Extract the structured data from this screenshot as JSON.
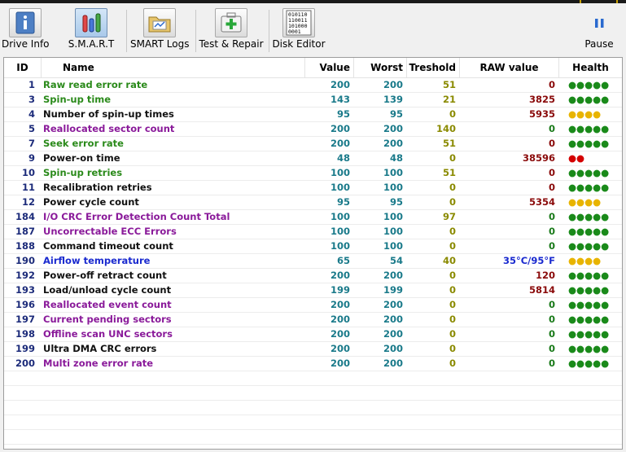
{
  "toolbar": {
    "buttons": [
      {
        "label": "Drive Info",
        "icon": "info-icon"
      },
      {
        "label": "S.M.A.R.T",
        "icon": "smart-chart-icon",
        "active": true
      },
      {
        "label": "SMART Logs",
        "icon": "logs-folder-icon"
      },
      {
        "label": "Test & Repair",
        "icon": "medkit-icon"
      },
      {
        "label": "Disk Editor",
        "icon": "binary-editor-icon"
      },
      {
        "label": "Pause",
        "icon": "pause-icon"
      }
    ],
    "disk_editor_glyph": [
      "010110",
      "110011",
      "101000",
      "0001"
    ]
  },
  "table": {
    "headers": {
      "id": "ID",
      "name": "Name",
      "value": "Value",
      "worst": "Worst",
      "threshold": "Treshold",
      "raw": "RAW value",
      "health": "Health"
    },
    "colors": {
      "green": "#2a8a1a",
      "purple": "#8a1a9a",
      "black": "#111111",
      "blue": "#1a2acf",
      "raw_red": "#8a0a0a",
      "raw_green": "#1a7a1a",
      "health_green": "#1a8a1a",
      "health_yellow": "#e8b400",
      "health_red": "#d40000"
    },
    "rows": [
      {
        "id": "1",
        "name": "Raw read error rate",
        "value": "200",
        "worst": "200",
        "threshold": "51",
        "raw": "0",
        "health": "●●●●●",
        "name_color": "green",
        "raw_color": "raw_red",
        "health_color": "health_green"
      },
      {
        "id": "3",
        "name": "Spin-up time",
        "value": "143",
        "worst": "139",
        "threshold": "21",
        "raw": "3825",
        "health": "●●●●●",
        "name_color": "green",
        "raw_color": "raw_red",
        "health_color": "health_green"
      },
      {
        "id": "4",
        "name": "Number of spin-up times",
        "value": "95",
        "worst": "95",
        "threshold": "0",
        "raw": "5935",
        "health": "●●●●",
        "name_color": "black",
        "raw_color": "raw_red",
        "health_color": "health_yellow"
      },
      {
        "id": "5",
        "name": "Reallocated sector count",
        "value": "200",
        "worst": "200",
        "threshold": "140",
        "raw": "0",
        "health": "●●●●●",
        "name_color": "purple",
        "raw_color": "raw_green",
        "health_color": "health_green"
      },
      {
        "id": "7",
        "name": "Seek error rate",
        "value": "200",
        "worst": "200",
        "threshold": "51",
        "raw": "0",
        "health": "●●●●●",
        "name_color": "green",
        "raw_color": "raw_red",
        "health_color": "health_green"
      },
      {
        "id": "9",
        "name": "Power-on time",
        "value": "48",
        "worst": "48",
        "threshold": "0",
        "raw": "38596",
        "health": "●●",
        "name_color": "black",
        "raw_color": "raw_red",
        "health_color": "health_red"
      },
      {
        "id": "10",
        "name": "Spin-up retries",
        "value": "100",
        "worst": "100",
        "threshold": "51",
        "raw": "0",
        "health": "●●●●●",
        "name_color": "green",
        "raw_color": "raw_red",
        "health_color": "health_green"
      },
      {
        "id": "11",
        "name": "Recalibration retries",
        "value": "100",
        "worst": "100",
        "threshold": "0",
        "raw": "0",
        "health": "●●●●●",
        "name_color": "black",
        "raw_color": "raw_red",
        "health_color": "health_green"
      },
      {
        "id": "12",
        "name": "Power cycle count",
        "value": "95",
        "worst": "95",
        "threshold": "0",
        "raw": "5354",
        "health": "●●●●",
        "name_color": "black",
        "raw_color": "raw_red",
        "health_color": "health_yellow"
      },
      {
        "id": "184",
        "name": "I/O CRC Error Detection Count Total",
        "value": "100",
        "worst": "100",
        "threshold": "97",
        "raw": "0",
        "health": "●●●●●",
        "name_color": "purple",
        "raw_color": "raw_green",
        "health_color": "health_green"
      },
      {
        "id": "187",
        "name": "Uncorrectable ECC Errors",
        "value": "100",
        "worst": "100",
        "threshold": "0",
        "raw": "0",
        "health": "●●●●●",
        "name_color": "purple",
        "raw_color": "raw_green",
        "health_color": "health_green"
      },
      {
        "id": "188",
        "name": "Command timeout count",
        "value": "100",
        "worst": "100",
        "threshold": "0",
        "raw": "0",
        "health": "●●●●●",
        "name_color": "black",
        "raw_color": "raw_green",
        "health_color": "health_green"
      },
      {
        "id": "190",
        "name": "Airflow temperature",
        "value": "65",
        "worst": "54",
        "threshold": "40",
        "raw": "35°C/95°F",
        "health": "●●●●",
        "name_color": "blue",
        "raw_color": "blue",
        "health_color": "health_yellow"
      },
      {
        "id": "192",
        "name": "Power-off retract count",
        "value": "200",
        "worst": "200",
        "threshold": "0",
        "raw": "120",
        "health": "●●●●●",
        "name_color": "black",
        "raw_color": "raw_red",
        "health_color": "health_green"
      },
      {
        "id": "193",
        "name": "Load/unload cycle count",
        "value": "199",
        "worst": "199",
        "threshold": "0",
        "raw": "5814",
        "health": "●●●●●",
        "name_color": "black",
        "raw_color": "raw_red",
        "health_color": "health_green"
      },
      {
        "id": "196",
        "name": "Reallocated event count",
        "value": "200",
        "worst": "200",
        "threshold": "0",
        "raw": "0",
        "health": "●●●●●",
        "name_color": "purple",
        "raw_color": "raw_green",
        "health_color": "health_green"
      },
      {
        "id": "197",
        "name": "Current pending sectors",
        "value": "200",
        "worst": "200",
        "threshold": "0",
        "raw": "0",
        "health": "●●●●●",
        "name_color": "purple",
        "raw_color": "raw_green",
        "health_color": "health_green"
      },
      {
        "id": "198",
        "name": "Offline scan UNC sectors",
        "value": "200",
        "worst": "200",
        "threshold": "0",
        "raw": "0",
        "health": "●●●●●",
        "name_color": "purple",
        "raw_color": "raw_green",
        "health_color": "health_green"
      },
      {
        "id": "199",
        "name": "Ultra DMA CRC errors",
        "value": "200",
        "worst": "200",
        "threshold": "0",
        "raw": "0",
        "health": "●●●●●",
        "name_color": "black",
        "raw_color": "raw_green",
        "health_color": "health_green"
      },
      {
        "id": "200",
        "name": "Multi zone error rate",
        "value": "200",
        "worst": "200",
        "threshold": "0",
        "raw": "0",
        "health": "●●●●●",
        "name_color": "purple",
        "raw_color": "raw_green",
        "health_color": "health_green"
      }
    ]
  }
}
